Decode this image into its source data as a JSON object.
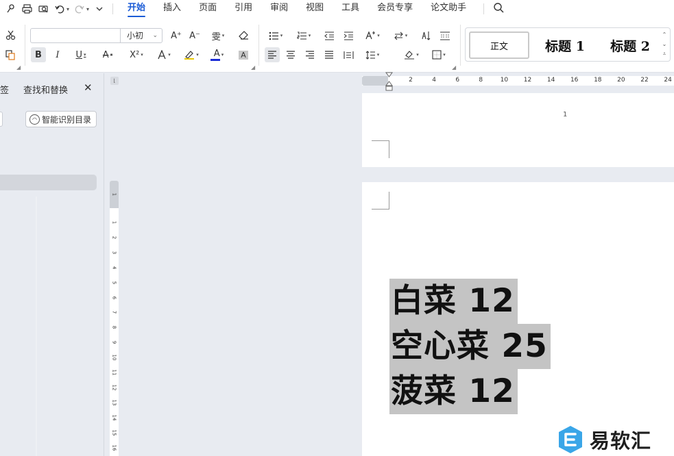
{
  "menu": {
    "tabs": [
      {
        "label": "开始",
        "active": true
      },
      {
        "label": "插入"
      },
      {
        "label": "页面"
      },
      {
        "label": "引用"
      },
      {
        "label": "审阅"
      },
      {
        "label": "视图"
      },
      {
        "label": "工具"
      },
      {
        "label": "会员专享"
      },
      {
        "label": "论文助手"
      }
    ],
    "quick_access_icons": [
      "format-painter-icon",
      "print-icon",
      "print-preview-icon",
      "undo-icon",
      "redo-icon",
      "more-icon"
    ],
    "accent_color": "#1a5bd6"
  },
  "ribbon": {
    "font_name": "",
    "font_size": "小初",
    "bold": "B",
    "italic": "I",
    "underline": "U",
    "strikethrough": "A",
    "superscript": "X²",
    "font_color_label": "A",
    "font_color": "#1a2bd6",
    "shading_label": "A",
    "grow_font": "A⁺",
    "shrink_font": "A⁻",
    "phonetic": "雯",
    "styles": {
      "normal": "正文",
      "heading1": "标题 1",
      "heading2": "标题 2"
    }
  },
  "nav_pane": {
    "tab_partial": "签",
    "tab_find": "查找和替换",
    "smart_toc_button": "智能识别目录"
  },
  "rulers": {
    "horizontal_ticks": [
      "2",
      "4",
      "6",
      "8",
      "10",
      "12",
      "14",
      "16",
      "18",
      "20",
      "22",
      "24"
    ],
    "vertical_ticks": [
      "1",
      "1",
      "2",
      "3",
      "4",
      "5",
      "6",
      "7",
      "8",
      "9",
      "10",
      "11",
      "12",
      "13",
      "14",
      "15",
      "16"
    ]
  },
  "document": {
    "page1_number": "1",
    "lines": [
      "白菜 12",
      "空心菜 25",
      "菠菜 12"
    ],
    "selection_color": "#c4c4c4"
  },
  "watermark": {
    "text": "易软汇",
    "icon_color": "#3aa6e8"
  }
}
